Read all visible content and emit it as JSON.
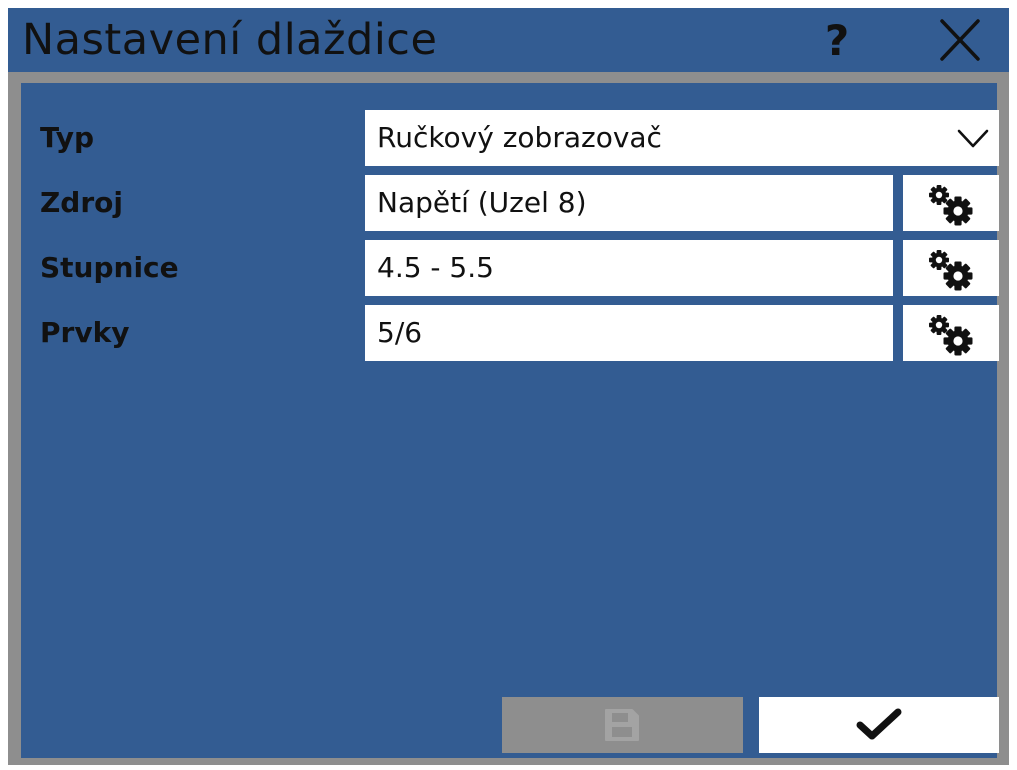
{
  "window": {
    "title": "Nastavení dlaždice",
    "help_label": "?",
    "close_icon": "close-icon"
  },
  "form": {
    "rows": [
      {
        "label": "Typ",
        "value": "Ručkový zobrazovač",
        "control": "select"
      },
      {
        "label": "Zdroj",
        "value": "Napětí (Uzel 8)",
        "control": "text",
        "action_icon": "gears-icon"
      },
      {
        "label": "Stupnice",
        "value": "4.5 - 5.5",
        "control": "text",
        "action_icon": "gears-icon"
      },
      {
        "label": "Prvky",
        "value": "5/6",
        "control": "text",
        "action_icon": "gears-icon"
      }
    ]
  },
  "footer": {
    "save_icon": "save-icon",
    "save_enabled": false,
    "ok_icon": "checkmark-icon"
  },
  "colors": {
    "panel": "#335c92",
    "frame": "#8e8e8e",
    "field": "#ffffff",
    "text": "#111111",
    "disabled_button": "#8e8e8e"
  }
}
